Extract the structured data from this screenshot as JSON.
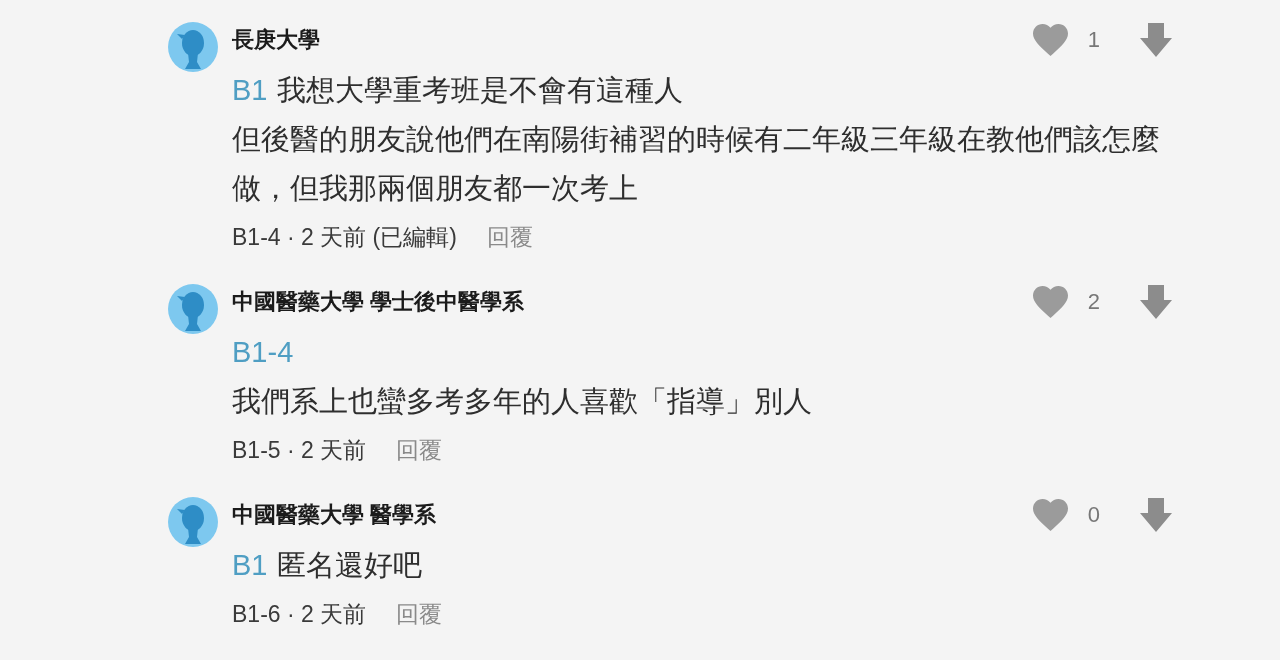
{
  "comments": [
    {
      "author": "長庚大學",
      "likes": "1",
      "liked": false,
      "lines": [
        {
          "mention": "B1",
          "text": "我想大學重考班是不會有這種人"
        },
        {
          "text": "但後醫的朋友說他們在南陽街補習的時候有二年級三年級在教他們該怎麼做，但我那兩個朋友都一次考上"
        }
      ],
      "meta": "B1-4 · 2 天前 (已編輯)",
      "reply": "回覆"
    },
    {
      "author": "中國醫藥大學 學士後中醫學系",
      "likes": "2",
      "liked": false,
      "lines": [
        {
          "mention": "B1-4"
        },
        {
          "text": "我們系上也蠻多考多年的人喜歡「指導」別人"
        }
      ],
      "meta": "B1-5 · 2 天前",
      "reply": "回覆"
    },
    {
      "author": "中國醫藥大學 醫學系",
      "likes": "0",
      "liked": false,
      "lines": [
        {
          "mention": "B1",
          "text": "匿名還好吧"
        }
      ],
      "meta": "B1-6 · 2 天前",
      "reply": "回覆"
    }
  ]
}
